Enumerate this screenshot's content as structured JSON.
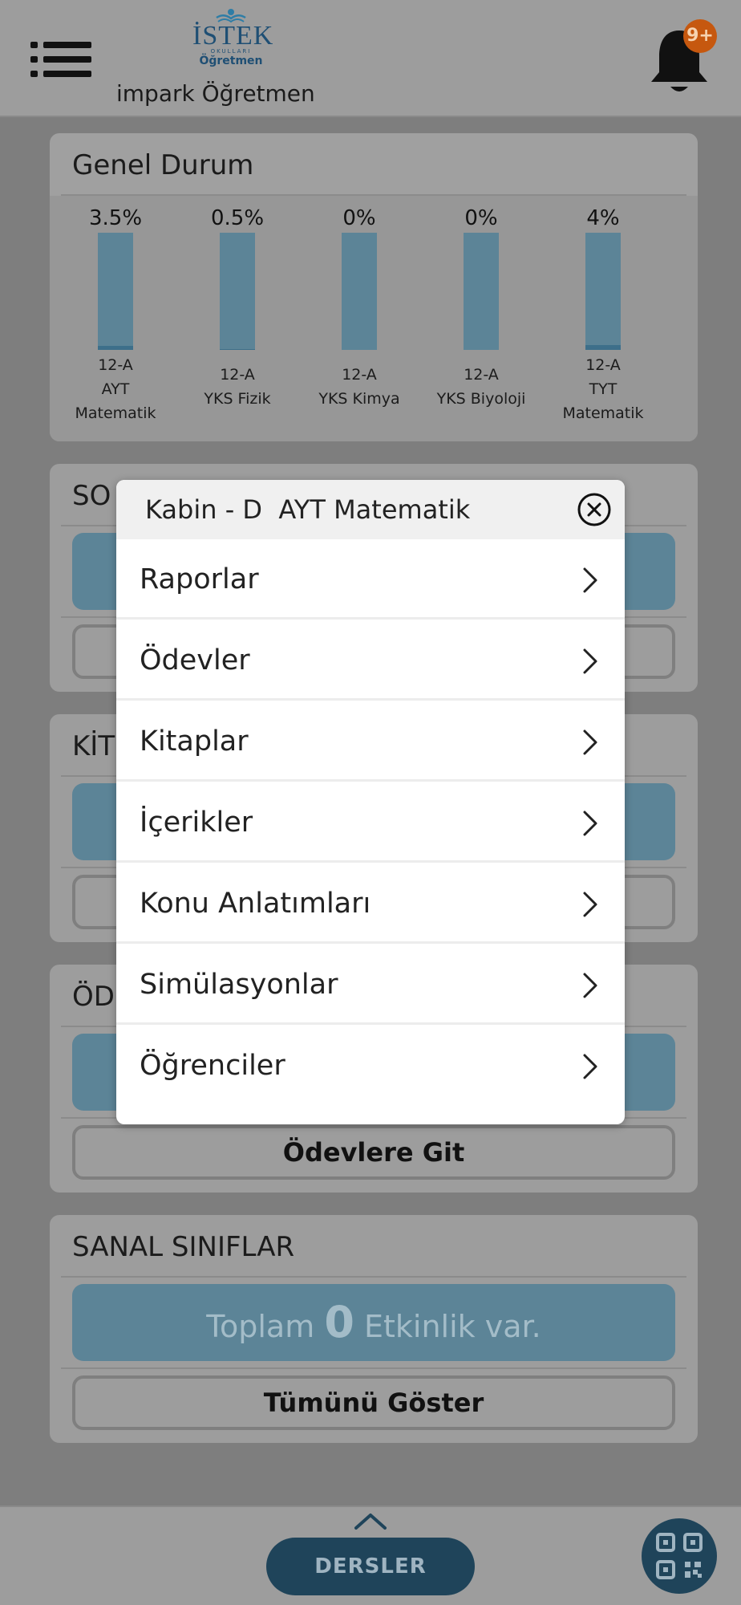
{
  "header": {
    "logo_word": "İSTEK",
    "logo_small": "OKULLARI",
    "logo_sub": "Öğretmen",
    "user_name": "impark Öğretmen",
    "notification_badge": "9+"
  },
  "general_status": {
    "title": "Genel Durum",
    "columns": [
      {
        "percent_label": "3.5%",
        "label_lines": [
          "12-A",
          "AYT",
          "Matematik"
        ]
      },
      {
        "percent_label": "0.5%",
        "label_lines": [
          "12-A",
          "YKS Fizik"
        ]
      },
      {
        "percent_label": "0%",
        "label_lines": [
          "12-A",
          "YKS Kimya"
        ]
      },
      {
        "percent_label": "0%",
        "label_lines": [
          "12-A",
          "YKS Biyoloji"
        ]
      },
      {
        "percent_label": "4%",
        "label_lines": [
          "12-A",
          "TYT",
          "Matematik"
        ]
      }
    ]
  },
  "chart_data": {
    "type": "bar",
    "categories": [
      "12-A AYT Matematik",
      "12-A YKS Fizik",
      "12-A YKS Kimya",
      "12-A YKS Biyoloji",
      "12-A TYT Matematik"
    ],
    "values": [
      3.5,
      0.5,
      0,
      0,
      4
    ],
    "title": "Genel Durum",
    "ylim": [
      0,
      100
    ]
  },
  "sections": {
    "s1_title_partial": "SO",
    "s2_title_partial": "KİT",
    "s3_title_partial": "ÖD",
    "s3_button": "Ödevlere Git",
    "virtual": {
      "title": "SANAL SINIFLAR",
      "total_prefix": "Toplam",
      "total_count": "0",
      "total_suffix": "Etkinlik var.",
      "show_all": "Tümünü Göster"
    }
  },
  "footer": {
    "courses_button": "DERSLER"
  },
  "modal": {
    "title": "Kabin - D  AYT Matematik",
    "items": [
      "Raporlar",
      "Ödevler",
      "Kitaplar",
      "İçerikler",
      "Konu Anlatımları",
      "Simülasyonlar",
      "Öğrenciler"
    ]
  },
  "colors": {
    "bar": "#5c8497",
    "navy": "#1f445a",
    "badge": "#c6580f"
  }
}
